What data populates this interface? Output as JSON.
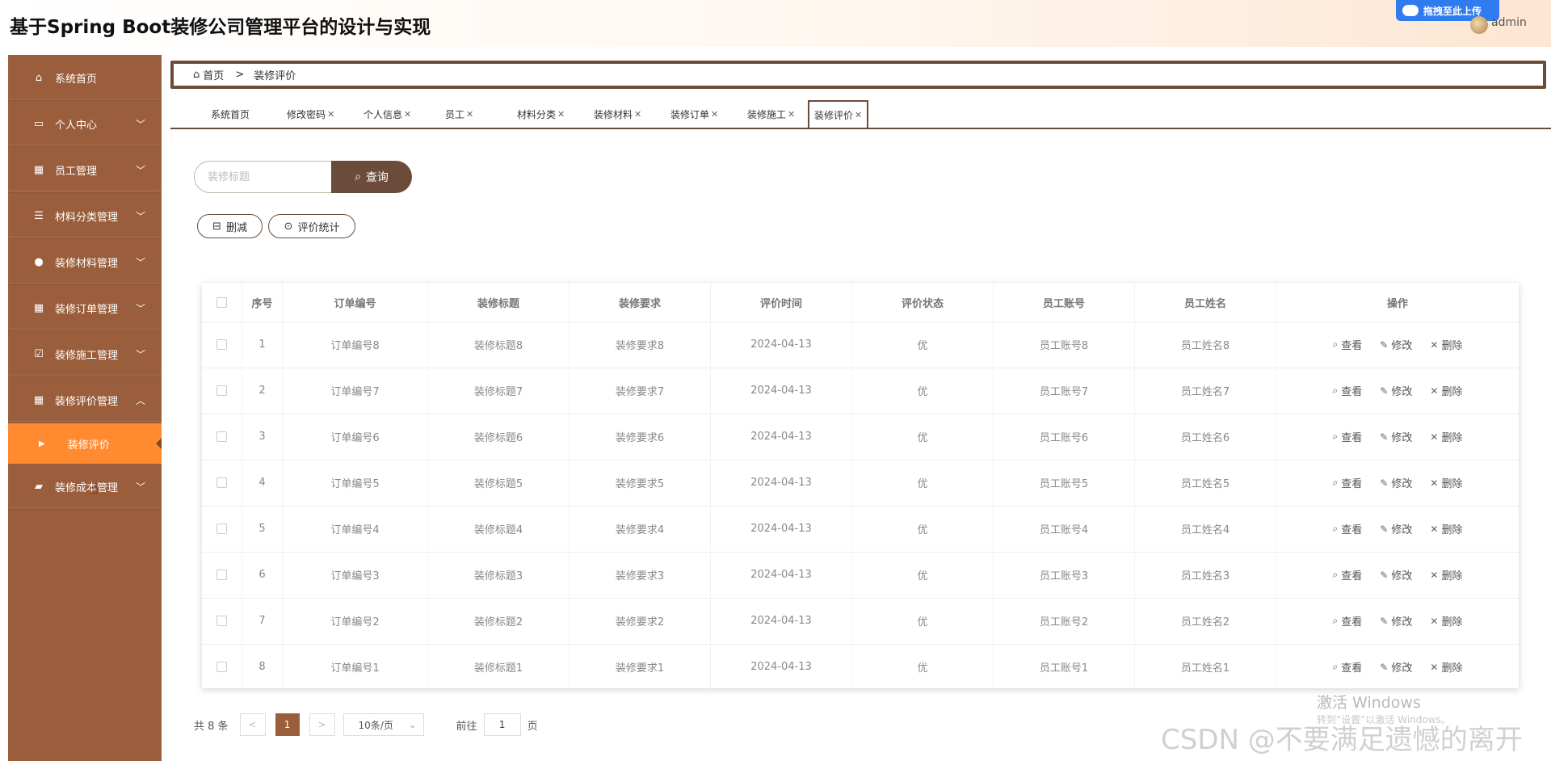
{
  "header": {
    "title": "基于Spring Boot装修公司管理平台的设计与实现",
    "upload_label": "拖拽至此上传",
    "user": "admin"
  },
  "sidebar": {
    "items": [
      {
        "label": "系统首页",
        "icon": "home-icon",
        "expandable": false
      },
      {
        "label": "个人中心",
        "icon": "card-icon",
        "expandable": true
      },
      {
        "label": "员工管理",
        "icon": "grid-icon",
        "expandable": true
      },
      {
        "label": "材料分类管理",
        "icon": "list-icon",
        "expandable": true
      },
      {
        "label": "装修材料管理",
        "icon": "bulb-icon",
        "expandable": true
      },
      {
        "label": "装修订单管理",
        "icon": "grid-icon",
        "expandable": true
      },
      {
        "label": "装修施工管理",
        "icon": "clipboard-icon",
        "expandable": true
      },
      {
        "label": "装修评价管理",
        "icon": "grid-icon",
        "expandable": true,
        "expanded": true
      },
      {
        "label": "装修成本管理",
        "icon": "folder-icon",
        "expandable": true
      }
    ],
    "active_sub": "装修评价"
  },
  "breadcrumb": {
    "home": "首页",
    "sep": ">",
    "current": "装修评价"
  },
  "tabs": [
    {
      "label": "系统首页",
      "closable": false
    },
    {
      "label": "修改密码",
      "closable": true
    },
    {
      "label": "个人信息",
      "closable": true
    },
    {
      "label": "员工",
      "closable": true
    },
    {
      "label": "材料分类",
      "closable": true
    },
    {
      "label": "装修材料",
      "closable": true
    },
    {
      "label": "装修订单",
      "closable": true
    },
    {
      "label": "装修施工",
      "closable": true
    },
    {
      "label": "装修评价",
      "closable": true,
      "active": true
    }
  ],
  "search": {
    "placeholder": "装修标题",
    "button": "查询"
  },
  "actions": {
    "delete": "删减",
    "stats": "评价统计"
  },
  "table": {
    "columns": [
      "序号",
      "订单编号",
      "装修标题",
      "装修要求",
      "评价时间",
      "评价状态",
      "员工账号",
      "员工姓名",
      "操作"
    ],
    "rows": [
      [
        "1",
        "订单编号8",
        "装修标题8",
        "装修要求8",
        "2024-04-13",
        "优",
        "员工账号8",
        "员工姓名8"
      ],
      [
        "2",
        "订单编号7",
        "装修标题7",
        "装修要求7",
        "2024-04-13",
        "优",
        "员工账号7",
        "员工姓名7"
      ],
      [
        "3",
        "订单编号6",
        "装修标题6",
        "装修要求6",
        "2024-04-13",
        "优",
        "员工账号6",
        "员工姓名6"
      ],
      [
        "4",
        "订单编号5",
        "装修标题5",
        "装修要求5",
        "2024-04-13",
        "优",
        "员工账号5",
        "员工姓名5"
      ],
      [
        "5",
        "订单编号4",
        "装修标题4",
        "装修要求4",
        "2024-04-13",
        "优",
        "员工账号4",
        "员工姓名4"
      ],
      [
        "6",
        "订单编号3",
        "装修标题3",
        "装修要求3",
        "2024-04-13",
        "优",
        "员工账号3",
        "员工姓名3"
      ],
      [
        "7",
        "订单编号2",
        "装修标题2",
        "装修要求2",
        "2024-04-13",
        "优",
        "员工账号2",
        "员工姓名2"
      ],
      [
        "8",
        "订单编号1",
        "装修标题1",
        "装修要求1",
        "2024-04-13",
        "优",
        "员工账号1",
        "员工姓名1"
      ]
    ],
    "ops": {
      "view": "查看",
      "edit": "修改",
      "delete": "删除"
    }
  },
  "pagination": {
    "total": "共 8 条",
    "prev": "<",
    "current": "1",
    "next": ">",
    "page_size": "10条/页",
    "goto_prefix": "前往",
    "goto_value": "1",
    "goto_suffix": "页"
  },
  "watermarks": {
    "windows": "激活 Windows",
    "windows_sub": "转到“设置”以激活 Windows。",
    "csdn": "CSDN @不要满足遗憾的离开"
  },
  "colors": {
    "sidebar": "#9a5e3c",
    "active": "#ff8a30",
    "accent": "#6b4b3a"
  }
}
